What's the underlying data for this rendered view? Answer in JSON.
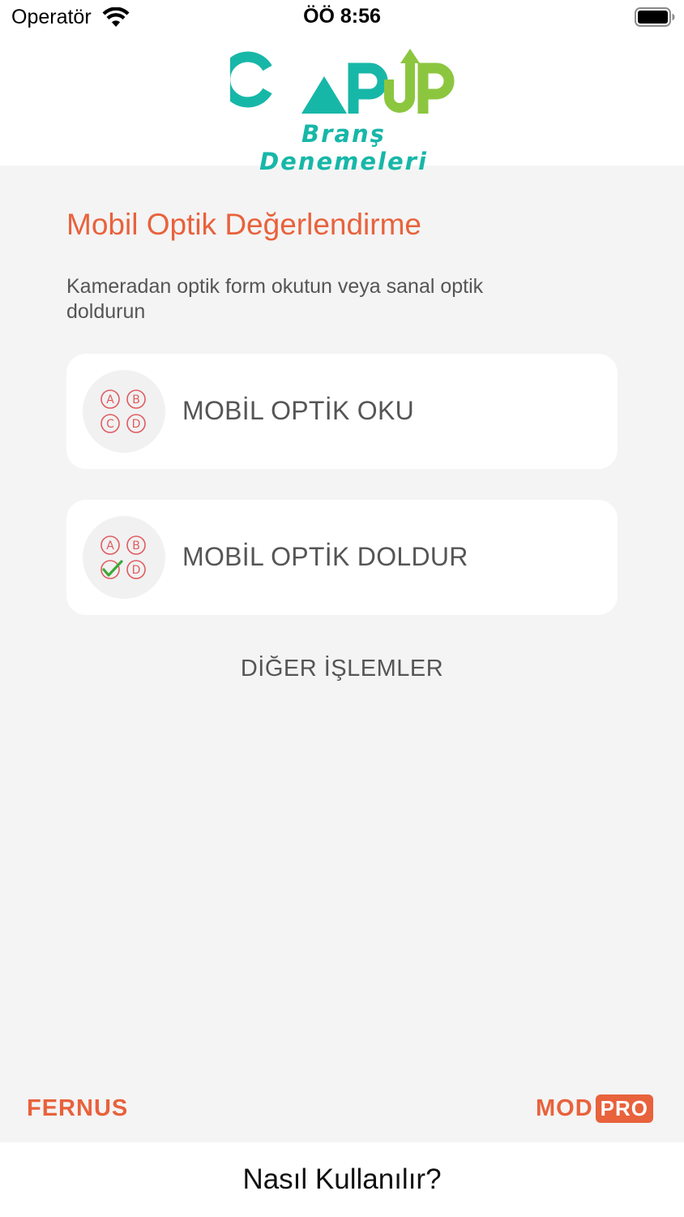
{
  "status_bar": {
    "carrier": "Operatör",
    "time": "ÖÖ 8:56"
  },
  "logo": {
    "word": "CAPUP",
    "subtitle": "Branş Denemeleri",
    "colors": {
      "teal": "#17b7a8",
      "green": "#8cc63f"
    }
  },
  "main": {
    "title": "Mobil Optik Değerlendirme",
    "subtitle": "Kameradan optik form okutun veya sanal optik doldurun",
    "cards": [
      {
        "label": "MOBİL OPTİK OKU",
        "icon": "abcd-options-icon"
      },
      {
        "label": "MOBİL OPTİK DOLDUR",
        "icon": "abcd-checked-icon"
      }
    ],
    "other_ops": "DİĞER İŞLEMLER"
  },
  "footer": {
    "brand_left": "FERNUS",
    "brand_right_mod": "MOD",
    "brand_right_pro": "PRO",
    "how_to": "Nasıl Kullanılır?"
  },
  "colors": {
    "accent": "#e8623c",
    "icon_red": "#e05b60",
    "check_green": "#3aaa35"
  }
}
